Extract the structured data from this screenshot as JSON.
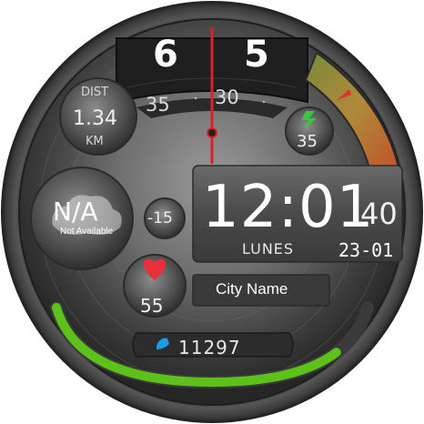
{
  "top_dial": {
    "hour_left": "6",
    "hour_right": "5",
    "minute_left": "35",
    "minute_right": "30",
    "pointer_color": "#e02020"
  },
  "distance": {
    "label": "DIST",
    "value": "1.34",
    "unit": "KM"
  },
  "battery": {
    "value": "35",
    "icon": "lightning-icon",
    "color": "#3cc43c"
  },
  "weather": {
    "condition": "N/A",
    "condition_sub": "Not Available",
    "temperature": "-15"
  },
  "time": {
    "hours_minutes": "12:01",
    "seconds": "40",
    "weekday": "LUNES",
    "date": "23-01"
  },
  "heart_rate": {
    "value": "55",
    "icon": "heart-icon",
    "color": "#e8303a"
  },
  "location": {
    "city": "City Name"
  },
  "steps": {
    "value": "11297",
    "icon": "shoe-icon",
    "icon_color": "#1e9be8",
    "progress": 0.85,
    "progress_color": "#5cc21a"
  }
}
